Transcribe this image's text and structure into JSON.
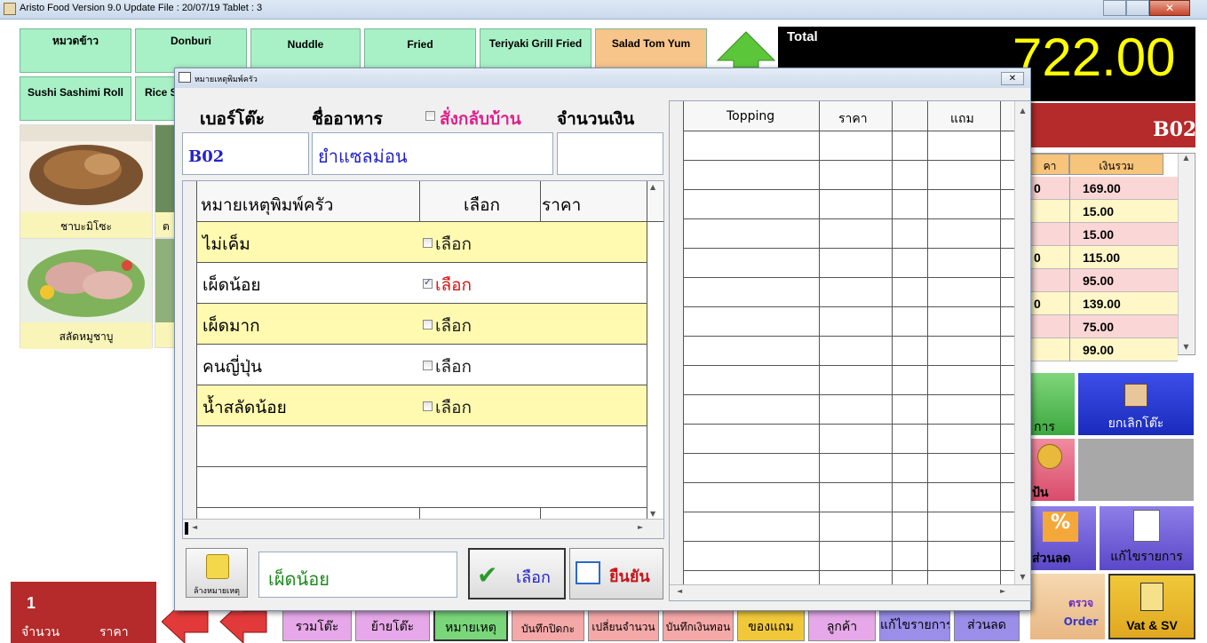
{
  "window": {
    "title": "Aristo Food  Version 9.0 Update File : 20/07/19 Tablet  : 3",
    "close_glyph": "✕"
  },
  "categories": [
    "หมวดข้าว",
    "Donburi",
    "Nuddle",
    "Fried",
    "Teriyaki Grill Fried",
    "Salad Tom Yum",
    "Sushi Sashimi Roll",
    "Rice S"
  ],
  "menu_tiles": [
    {
      "label": "ชาบะมิโซะ"
    },
    {
      "label": "สลัดหมูชาบู"
    },
    {
      "label": "ต"
    }
  ],
  "total": {
    "label": "Total",
    "value": "722.00"
  },
  "table_code": "B02",
  "order_grid": {
    "headers": [
      "คา",
      "เงินรวม"
    ],
    "rows": [
      {
        "qty": "0",
        "amount": "169.00"
      },
      {
        "qty": "",
        "amount": "15.00"
      },
      {
        "qty": "",
        "amount": "15.00"
      },
      {
        "qty": "0",
        "amount": "115.00"
      },
      {
        "qty": "",
        "amount": "95.00"
      },
      {
        "qty": "0",
        "amount": "139.00"
      },
      {
        "qty": "",
        "amount": "75.00"
      },
      {
        "qty": "",
        "amount": "99.00"
      }
    ]
  },
  "right_buttons": {
    "cancel_table": "ยกเลิกโต๊ะ",
    "right_partial_1": "การ",
    "right_partial_2": "ป้น",
    "discount": "ส่วนลด",
    "edit_items": "แก้ไขรายการ",
    "check_order_1": "ตรวจ",
    "check_order_2": "Order",
    "vat_sv": "Vat & SV"
  },
  "bottom_left": {
    "qty": "1",
    "qty_label": "จำนวน",
    "price_label": "ราคา"
  },
  "bottom_bar": [
    "รวมโต๊ะ",
    "ย้ายโต๊ะ",
    "หมายเหตุ",
    "บันทึกปิดกะ",
    "เปลี่ยนจำนวน",
    "บันทึกเงินทอน",
    "ของแถม",
    "ลูกค้า",
    "แก้ไขรายการ",
    "ส่วนลด"
  ],
  "dialog": {
    "title": "หมายเหตุพิมพ์ครัว",
    "table_label": "เบอร์โต๊ะ",
    "food_label": "ชื่ออาหาร",
    "takeaway_label": "สั่งกลับบ้าน",
    "amount_label": "จำนวนเงิน",
    "table_value": "B02",
    "food_value": "ยำแซลม่อน",
    "amount_value": "",
    "notes_header": {
      "note": "หมายเหตุพิมพ์ครัว",
      "select": "เลือก",
      "price": "ราคา"
    },
    "notes": [
      {
        "text": "ไม่เค็ม",
        "select": "เลือก",
        "checked": false,
        "price": ""
      },
      {
        "text": "เผ็ดน้อย",
        "select": "เลือก",
        "checked": true,
        "price": ""
      },
      {
        "text": "เผ็ดมาก",
        "select": "เลือก",
        "checked": false,
        "price": ""
      },
      {
        "text": "คนญี่ปุ่น",
        "select": "เลือก",
        "checked": false,
        "price": ""
      },
      {
        "text": "น้ำสลัดน้อย",
        "select": "เลือก",
        "checked": false,
        "price": ""
      }
    ],
    "topping_header": {
      "topping": "Topping",
      "price": "ราคา",
      "free": "แถม"
    },
    "clear_label": "ล้างหมายเหตุ",
    "selected_note": "เผ็ดน้อย",
    "select_button": "เลือก",
    "confirm_button": "ยืนยัน"
  },
  "colors": {
    "accent_red": "#b52a2a",
    "total_yellow": "#ffff00",
    "cat_green": "#a8f0c6",
    "cat_orange": "#f7c48a"
  }
}
